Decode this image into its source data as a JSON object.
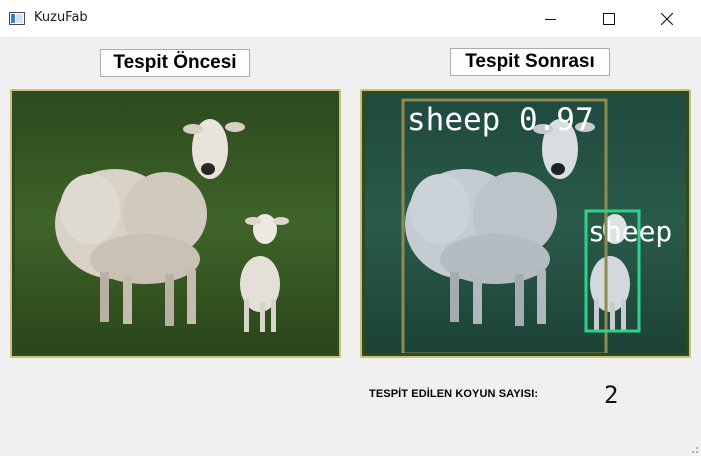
{
  "window": {
    "title": "KuzuFab"
  },
  "panels": {
    "before_label": "Tespit Öncesi",
    "after_label": "Tespit Sonrası"
  },
  "detections": {
    "box1_label": "sheep 0.97",
    "box2_label": "sheep"
  },
  "result": {
    "count_label": "TESPİT EDİLEN KOYUN SAYISI:",
    "count_value": "2"
  },
  "colors": {
    "frame_border": "#c9c174",
    "box_large": "#8e8a50",
    "box_small": "#2fd18a"
  }
}
